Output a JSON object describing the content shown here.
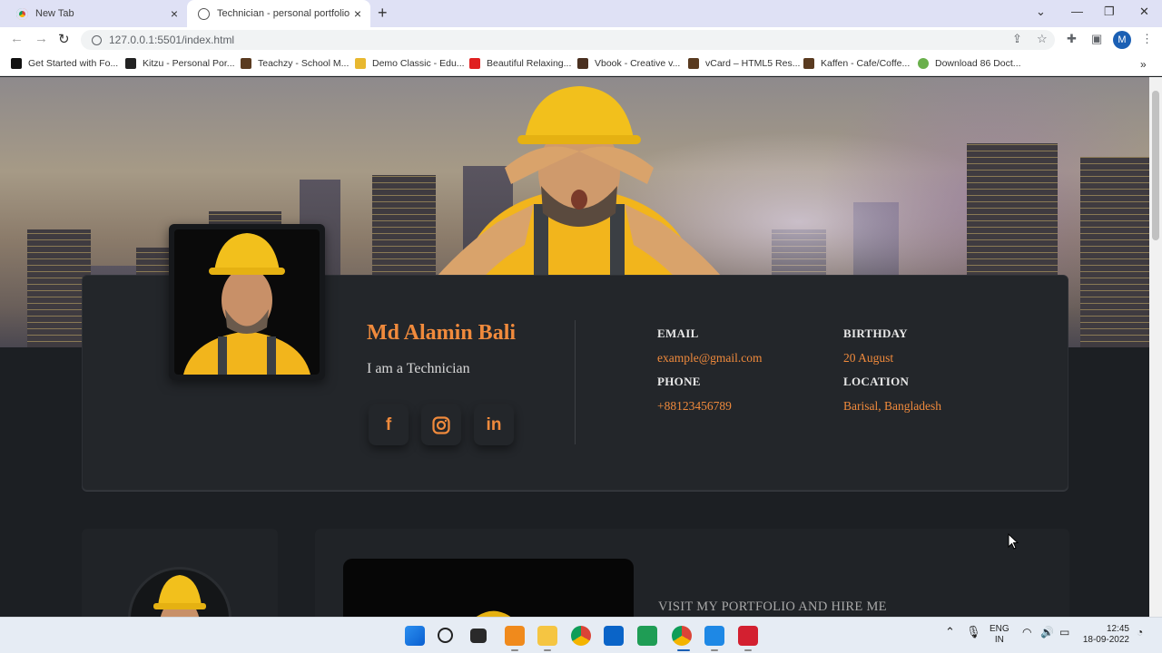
{
  "browser": {
    "tabs": [
      {
        "title": "New Tab",
        "active": false
      },
      {
        "title": "Technician - personal portfolio",
        "active": true
      }
    ],
    "url": "127.0.0.1:5501/index.html",
    "profile_initial": "M",
    "bookmarks": [
      {
        "label": "Get Started with Fo...",
        "color": "#111111"
      },
      {
        "label": "Kitzu - Personal Por...",
        "color": "#222222"
      },
      {
        "label": "Teachzy - School M...",
        "color": "#5a3b20"
      },
      {
        "label": "Demo Classic - Edu...",
        "color": "#e8b830"
      },
      {
        "label": "Beautiful Relaxing...",
        "color": "#e02020"
      },
      {
        "label": "Vbook - Creative v...",
        "color": "#4a3020"
      },
      {
        "label": "vCard – HTML5 Res...",
        "color": "#5a3b20"
      },
      {
        "label": "Kaffen - Cafe/Coffe...",
        "color": "#5a3b20"
      },
      {
        "label": "Download 86 Doct...",
        "color": "#6ab04c"
      }
    ]
  },
  "profile": {
    "name": "Md Alamin Bali",
    "role": "I am a Technician",
    "socials": [
      {
        "icon": "facebook-icon",
        "glyph": "f"
      },
      {
        "icon": "instagram-icon",
        "glyph": ""
      },
      {
        "icon": "linkedin-icon",
        "glyph": "in"
      }
    ],
    "contact": {
      "email_label": "EMAIL",
      "email": "example@gmail.com",
      "phone_label": "PHONE",
      "phone": "+88123456789",
      "birthday_label": "BIRTHDAY",
      "birthday": "20 August",
      "location_label": "LOCATION",
      "location": "Barisal, Bangladesh"
    }
  },
  "section": {
    "visit_text": "VISIT MY PORTFOLIO AND HIRE ME"
  },
  "colors": {
    "accent": "#f08a3c",
    "page_bg": "#1c1f23",
    "card_bg": "#23262a"
  },
  "taskbar": {
    "lang_top": "ENG",
    "lang_bottom": "IN",
    "time": "12:45",
    "date": "18-09-2022"
  }
}
